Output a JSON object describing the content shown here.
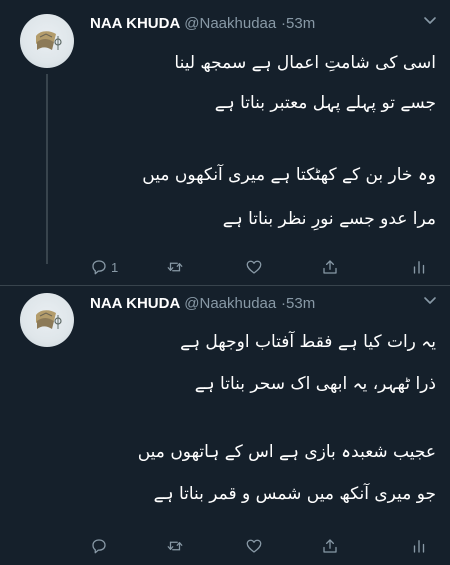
{
  "tweets": [
    {
      "author": {
        "name": "NAA KHUDA",
        "handle": "@Naakhudaa",
        "separator": "·",
        "time": "53m"
      },
      "lines": [
        "اسی کی شامتِ اعمال ہے سمجھ لینا",
        "جسے تو پہلے پہل معتبر بناتا ہے",
        "وہ خار بن کے کھٹکتا ہے میری آنکھوں میں",
        "مرا عدو جسے نورِ نظر بناتا ہے"
      ],
      "actions": {
        "reply_count": "1",
        "retweet_count": "",
        "like_count": ""
      }
    },
    {
      "author": {
        "name": "NAA KHUDA",
        "handle": "@Naakhudaa",
        "separator": "·",
        "time": "53m"
      },
      "lines": [
        "یہ رات کیا ہے فقط آفتاب اوجھل ہے",
        "ذرا ٹھہر، یہ ابھی اک سحر بناتا ہے",
        "عجیب شعبدہ بازی ہے اس کے ہاتھوں میں",
        "جو میری آنکھ میں شمس و قمر بناتا ہے"
      ],
      "actions": {
        "reply_count": "",
        "retweet_count": "",
        "like_count": ""
      }
    }
  ],
  "icons": {
    "reply": "reply-icon",
    "retweet": "retweet-icon",
    "like": "heart-icon",
    "share": "share-icon",
    "analytics": "analytics-icon",
    "more": "chevron-down-icon"
  },
  "colors": {
    "background": "#15202b",
    "secondary_text": "#8899a6",
    "divider": "#38444d"
  }
}
